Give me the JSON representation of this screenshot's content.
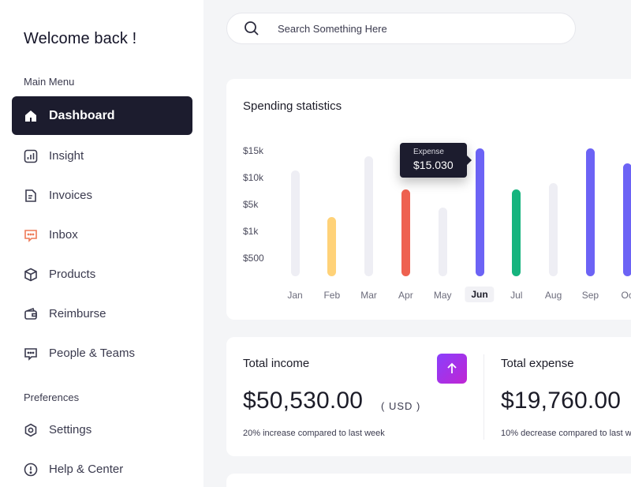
{
  "sidebar": {
    "welcome": "Welcome back !",
    "main_menu_label": "Main Menu",
    "preferences_label": "Preferences",
    "items": [
      {
        "label": "Dashboard",
        "icon": "home-icon",
        "active": true
      },
      {
        "label": "Insight",
        "icon": "chart-icon"
      },
      {
        "label": "Invoices",
        "icon": "document-icon"
      },
      {
        "label": "Inbox",
        "icon": "chat-icon"
      },
      {
        "label": "Products",
        "icon": "box-icon"
      },
      {
        "label": "Reimburse",
        "icon": "wallet-icon"
      },
      {
        "label": "People & Teams",
        "icon": "people-chat-icon"
      }
    ],
    "pref_items": [
      {
        "label": "Settings",
        "icon": "gear-icon"
      },
      {
        "label": "Help & Center",
        "icon": "help-icon"
      }
    ]
  },
  "search": {
    "placeholder": "Search Something Here"
  },
  "spending": {
    "title": "Spending statistics",
    "tooltip_label": "Expense",
    "tooltip_value": "$15.030"
  },
  "chart_data": {
    "type": "bar",
    "title": "Spending statistics",
    "y_tick_labels": [
      "$15k",
      "$10k",
      "$5k",
      "$1k",
      "$500"
    ],
    "categories": [
      "Jan",
      "Feb",
      "Mar",
      "Apr",
      "May",
      "Jun",
      "Jul",
      "Aug",
      "Sep",
      "Oc"
    ],
    "selected_category": "Jun",
    "values_relative_to_max": [
      0.83,
      0.46,
      0.94,
      0.68,
      0.54,
      1.0,
      0.68,
      0.73,
      1.0,
      0.88
    ],
    "colors": [
      "#eeeef4",
      "#ffd278",
      "#eeeef4",
      "#ee6150",
      "#eeeef4",
      "#6c63f5",
      "#16b47e",
      "#eeeef4",
      "#6c63f5",
      "#6c63f5"
    ]
  },
  "income": {
    "title": "Total income",
    "amount": "$50,530.00",
    "unit": "( USD )",
    "note": "20% increase compared to last week"
  },
  "expense": {
    "title": "Total expense",
    "amount": "$19,760.00",
    "note": "10% decrease compared to last w"
  },
  "colors": {
    "active_nav": "#1c1c2e",
    "accent_purple": "#8a3ffc",
    "inbox_icon": "#ee7a57"
  }
}
